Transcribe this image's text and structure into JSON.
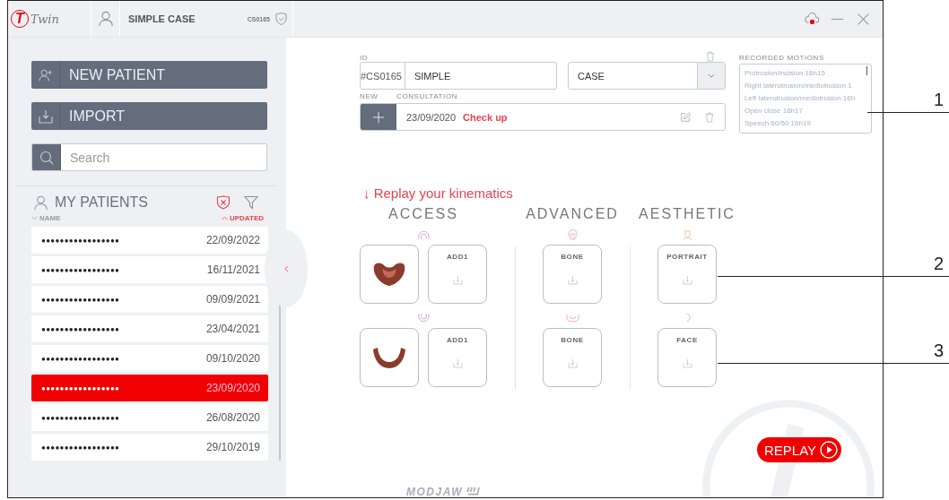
{
  "header": {
    "logo_letter": "T",
    "logo_text": "Twin",
    "case_name": "SIMPLE CASE",
    "case_id": "CS0165"
  },
  "sidebar": {
    "actions": [
      {
        "kind": "new",
        "label": "NEW PATIENT"
      },
      {
        "kind": "import",
        "label": "IMPORT"
      }
    ],
    "search": {
      "placeholder": "Search"
    },
    "patients_title": "MY PATIENTS",
    "sort_columns": [
      {
        "label": "NAME",
        "selected": false
      },
      {
        "label": "UPDATED",
        "selected": true
      }
    ],
    "patients": [
      {
        "name": "●●●●●●●●●●●●●●●●●",
        "updated": "22/09/2022",
        "selected": false
      },
      {
        "name": "●●●●●●●●●●●●●●●●●",
        "updated": "16/11/2021",
        "selected": false
      },
      {
        "name": "●●●●●●●●●●●●●●●●●",
        "updated": "09/09/2021",
        "selected": false
      },
      {
        "name": "●●●●●●●●●●●●●●●●●",
        "updated": "23/04/2021",
        "selected": false
      },
      {
        "name": "●●●●●●●●●●●●●●●●●",
        "updated": "09/10/2020",
        "selected": false
      },
      {
        "name": "●●●●●●●●●●●●●●●●●",
        "updated": "23/09/2020",
        "selected": true
      },
      {
        "name": "●●●●●●●●●●●●●●●●●",
        "updated": "26/08/2020",
        "selected": false
      },
      {
        "name": "●●●●●●●●●●●●●●●●●",
        "updated": "29/10/2019",
        "selected": false
      }
    ]
  },
  "case_form": {
    "id_label": "ID",
    "id_prefix": "#CS0165",
    "name_value": "SIMPLE",
    "type_value": "CASE",
    "new_label": "NEW",
    "consultation_label": "CONSULTATION",
    "consultation_date": "23/09/2020",
    "consultation_title": "Check up"
  },
  "recorded_motions": {
    "title": "RECORDED MOTIONS",
    "items": [
      "Protrusion/incision 16h15",
      "Right laterotrusion/mediotrusion 1",
      "Left laterotrusion/mediotrusion 16h",
      "Open close 16h17",
      "Speech 60/50 16h19"
    ]
  },
  "kinematics": {
    "heading": "↓ Replay your kinematics",
    "groups": [
      {
        "title": "ACCESS",
        "rows": [
          [
            {
              "kind": "upper-scan"
            },
            {
              "kind": "upload",
              "label": "ADD1"
            }
          ],
          [
            {
              "kind": "lower-scan"
            },
            {
              "kind": "upload",
              "label": "ADD1"
            }
          ]
        ]
      },
      {
        "title": "ADVANCED",
        "rows": [
          [
            {
              "kind": "upload",
              "label": "BONE"
            }
          ],
          [
            {
              "kind": "upload",
              "label": "BONE"
            }
          ]
        ]
      },
      {
        "title": "AESTHETIC",
        "rows": [
          [
            {
              "kind": "upload",
              "label": "PORTRAIT"
            }
          ],
          [
            {
              "kind": "upload",
              "label": "FACE"
            }
          ]
        ]
      }
    ]
  },
  "replay_button": "REPLAY",
  "footer_logo": "MODJAW",
  "callouts": [
    "1",
    "2",
    "3"
  ]
}
